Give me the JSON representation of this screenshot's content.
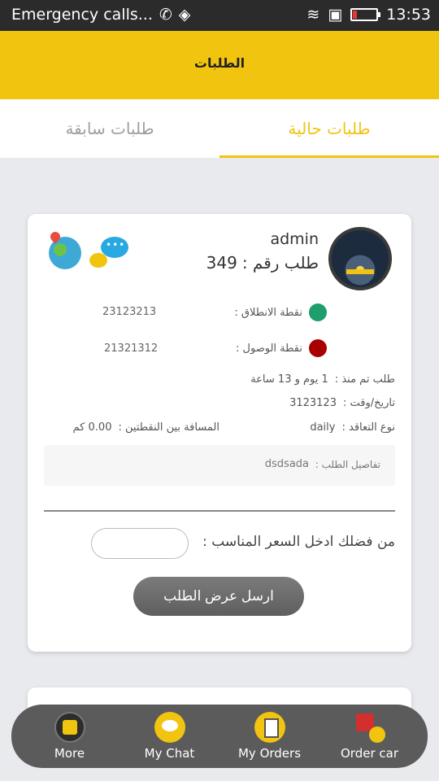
{
  "status_bar": {
    "carrier": "Emergency calls...",
    "time": "13:53"
  },
  "app_bar": {
    "title": "الطلبات"
  },
  "tabs": [
    {
      "label": "طلبات حالية",
      "active": true
    },
    {
      "label": "طلبات سابقة",
      "active": false
    }
  ],
  "order": {
    "username": "admin",
    "order_number_label": "طلب رقم :",
    "order_number": "349",
    "start_label": "نقطة الانطلاق :",
    "start_value": "23123213",
    "end_label": "نقطة الوصول :",
    "end_value": "21321312",
    "since_label": "طلب تم منذ :",
    "since_value": "1 يوم و 13 ساعة",
    "datetime_label": "تاريخ/وقت :",
    "datetime_value": "3123123",
    "contract_label": "نوع التعاقد :",
    "contract_value": "daily",
    "distance_label": "المسافة بين النقطتين :",
    "distance_value": "0.00 كم",
    "details_label": "تفاصيل الطلب :",
    "details_value": "dsdsada",
    "price_label": "من فضلك ادخل السعر المناسب :",
    "price_value": "",
    "send_button": "ارسل عرض الطلب"
  },
  "bottom_nav": [
    {
      "label": "More",
      "icon": "grid-icon"
    },
    {
      "label": "My Chat",
      "icon": "chat-icon"
    },
    {
      "label": "My Orders",
      "icon": "orders-icon"
    },
    {
      "label": "Order car",
      "icon": "car-icon"
    }
  ],
  "colors": {
    "accent": "#f1c40f",
    "nav_bg": "#5b5b5b",
    "status_bg": "#2b2b2b"
  }
}
